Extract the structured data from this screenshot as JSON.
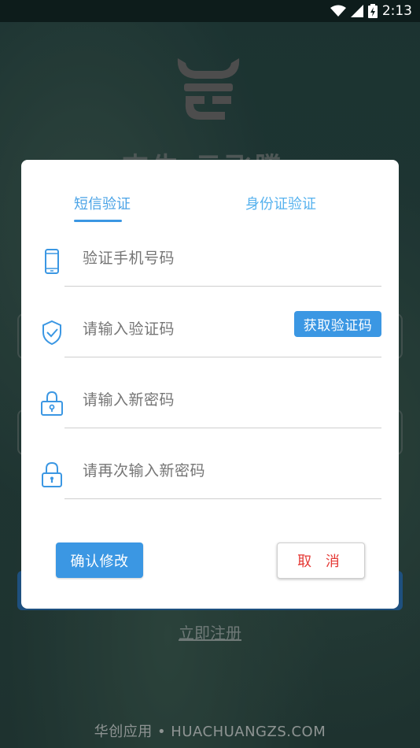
{
  "status_bar": {
    "time": "2:13"
  },
  "background": {
    "app_title": "吉牛·云飞腾",
    "register_link": "立即注册",
    "footer": "华创应用 • HUACHUANGZS.COM"
  },
  "dialog": {
    "tabs": [
      {
        "label": "短信验证",
        "active": true
      },
      {
        "label": "身份证验证",
        "active": false
      }
    ],
    "fields": {
      "phone_placeholder": "验证手机号码",
      "code_placeholder": "请输入验证码",
      "new_password_placeholder": "请输入新密码",
      "confirm_password_placeholder": "请再次输入新密码"
    },
    "get_code_label": "获取验证码",
    "confirm_label": "确认修改",
    "cancel_label": "取 消"
  },
  "colors": {
    "accent": "#3b97e3",
    "cancel_text": "#e53935"
  }
}
